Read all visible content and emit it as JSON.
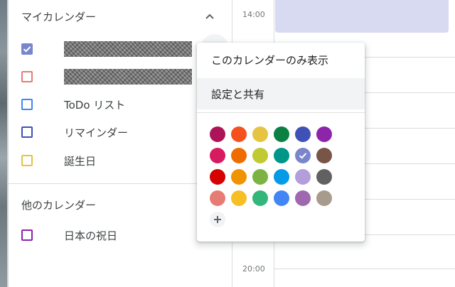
{
  "sidebar": {
    "my_calendars_header": "マイカレンダー",
    "other_calendars_header": "他のカレンダー",
    "my_calendars": [
      {
        "label": "",
        "color": "#7986cb",
        "checked": true,
        "redacted": true
      },
      {
        "label": "",
        "color": "#e67c73",
        "checked": false,
        "redacted": true
      },
      {
        "label": "ToDo リスト",
        "color": "#4285f4",
        "checked": false,
        "redacted": false
      },
      {
        "label": "リマインダー",
        "color": "#3f51b5",
        "checked": false,
        "redacted": false
      },
      {
        "label": "誕生日",
        "color": "#e4c441",
        "checked": false,
        "redacted": false
      }
    ],
    "other_calendars": [
      {
        "label": "日本の祝日",
        "color": "#8e24aa",
        "checked": false
      }
    ]
  },
  "grid": {
    "time_labels": [
      "14:00",
      "20:00"
    ]
  },
  "popup": {
    "items": [
      "このカレンダーのみ表示",
      "設定と共有"
    ],
    "selected_color": "#7986cb",
    "colors": [
      [
        "#ad1457",
        "#f4511e",
        "#e4c441",
        "#0b8043",
        "#3f51b5",
        "#8e24aa"
      ],
      [
        "#d81b60",
        "#ef6c00",
        "#c0ca33",
        "#009688",
        "#7986cb",
        "#795548"
      ],
      [
        "#d50000",
        "#f09300",
        "#7cb342",
        "#039be5",
        "#b39ddb",
        "#616161"
      ],
      [
        "#e67c73",
        "#f6bf26",
        "#33b679",
        "#4285f4",
        "#9e69af",
        "#a79b8e"
      ]
    ],
    "add_color_icon": "plus-icon"
  }
}
